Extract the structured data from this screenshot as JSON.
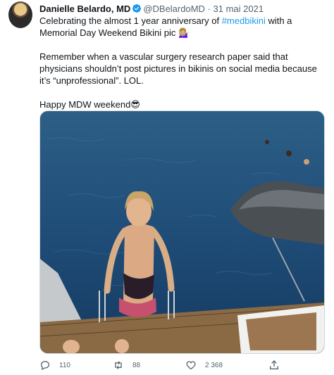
{
  "author": {
    "name": "Danielle Belardo, MD",
    "handle": "@DBelardoMD",
    "separator": "·",
    "date": "31 mai 2021"
  },
  "text": {
    "line1_before": "Celebrating the almost 1 year anniversary of ",
    "hashtag": "#medbikini",
    "line1_after": " with a Memorial Day Weekend Bikini pic 💁🏼‍♀️",
    "para2": "Remember when a vascular surgery research paper said that physicians shouldn’t post pictures in bikinis on social media because it’s “unprofessional”. LOL.",
    "para3": "Happy MDW weekend😎"
  },
  "actions": {
    "replies": "110",
    "retweets": "88",
    "likes": "2 368"
  },
  "colors": {
    "link": "#1d9bf0",
    "verified": "#1d9bf0",
    "secondary_text": "#536471",
    "border": "#cfd9de"
  }
}
